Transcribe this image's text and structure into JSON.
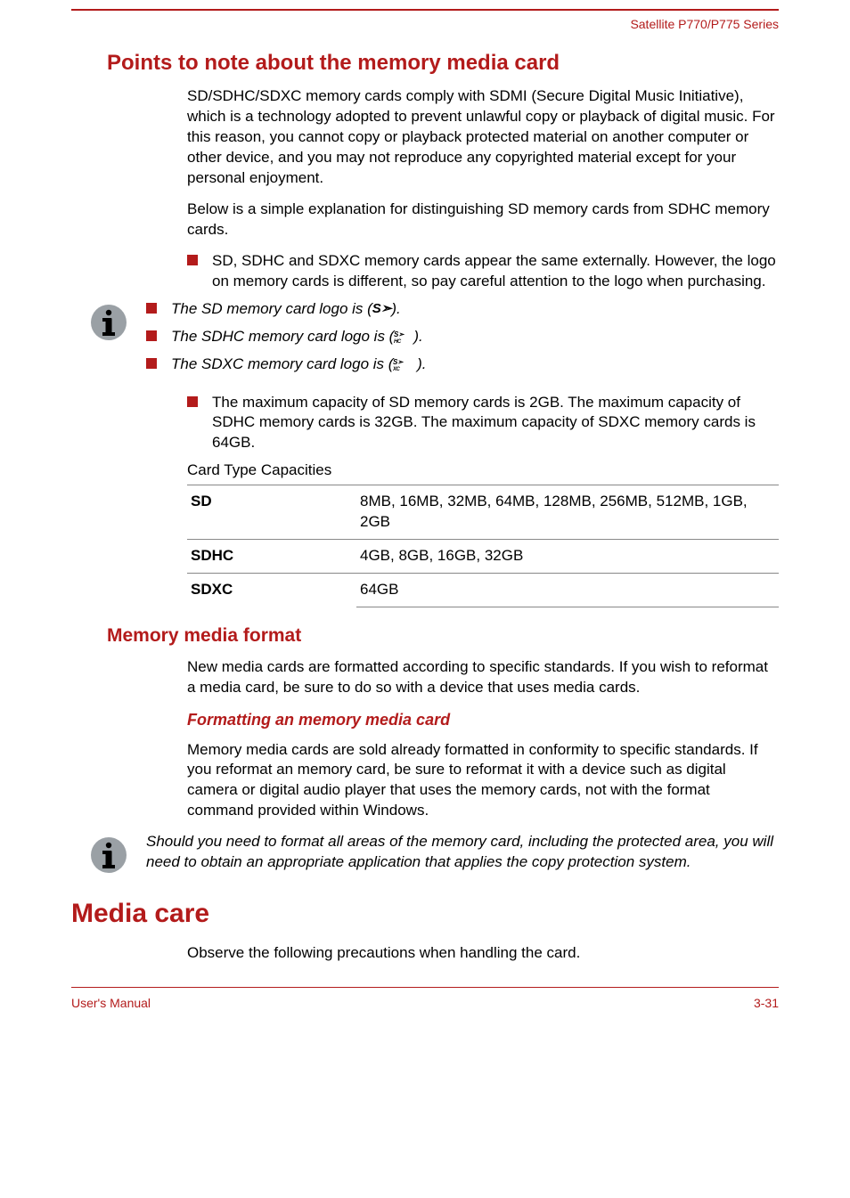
{
  "header": {
    "series": "Satellite P770/P775 Series"
  },
  "sections": {
    "points_title": "Points to note about the memory media card",
    "p1": "SD/SDHC/SDXC memory cards comply with SDMI (Secure Digital Music Initiative), which is a technology adopted to prevent unlawful copy or playback of digital music. For this reason, you cannot copy or playback protected material on another computer or other device, and you may not reproduce any copyrighted material except for your personal enjoyment.",
    "p2": "Below is a simple explanation for distinguishing SD memory cards from SDHC memory cards.",
    "bullet_ext": "SD, SDHC and SDXC memory cards appear the same externally. However, the logo on memory cards is different, so pay careful attention to the logo when purchasing.",
    "logo_items": {
      "sd_pre": "The SD memory card logo is (",
      "sdhc_pre": "The SDHC memory card logo is (",
      "sdxc_pre": "The SDXC memory card logo is (",
      "post": ")."
    },
    "bullet_cap": "The maximum capacity of SD memory cards is 2GB. The maximum capacity of SDHC memory cards is 32GB. The maximum capacity of SDXC memory cards is 64GB.",
    "cap_title": "Card Type Capacities",
    "cap_table": [
      {
        "type": "SD",
        "val": "8MB, 16MB, 32MB, 64MB, 128MB, 256MB, 512MB, 1GB, 2GB"
      },
      {
        "type": "SDHC",
        "val": "4GB, 8GB, 16GB, 32GB"
      },
      {
        "type": "SDXC",
        "val": "64GB"
      }
    ],
    "memfmt_title": "Memory media format",
    "memfmt_p": "New media cards are formatted according to specific standards. If you wish to reformat a media card, be sure to do so with a device that uses media cards.",
    "fmtcard_title": "Formatting an memory media card",
    "fmtcard_p": "Memory media cards are sold already formatted in conformity to specific standards. If you reformat an memory card, be sure to reformat it with a device such as digital camera or digital audio player that uses the memory cards, not with the format command provided within Windows.",
    "fmtcard_note": "Should you need to format all areas of the memory card, including the protected area, you will need to obtain an appropriate application that applies the copy protection system.",
    "mediacare_title": "Media care",
    "mediacare_p": "Observe the following precautions when handling the card."
  },
  "footer": {
    "left": "User's Manual",
    "right": "3-31"
  }
}
